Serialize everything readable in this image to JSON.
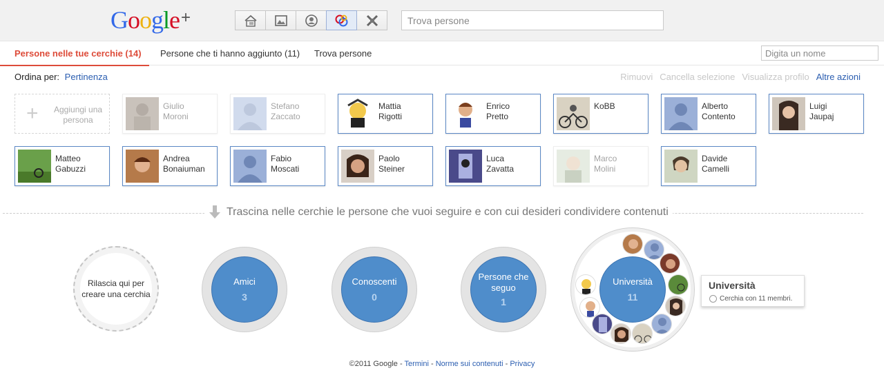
{
  "search": {
    "placeholder": "Trova persone"
  },
  "nav": [
    {
      "icon": "home-icon"
    },
    {
      "icon": "photos-icon"
    },
    {
      "icon": "profile-icon"
    },
    {
      "icon": "circles-icon"
    },
    {
      "icon": "games-icon"
    }
  ],
  "tabs": [
    {
      "label": "Persone nelle tue cerchie (14)"
    },
    {
      "label": "Persone che ti hanno aggiunto (11)"
    },
    {
      "label": "Trova persone"
    }
  ],
  "name_filter": {
    "placeholder": "Digita un nome"
  },
  "sort": {
    "label": "Ordina per:",
    "value": "Pertinenza"
  },
  "actions": [
    {
      "label": "Rimuovi"
    },
    {
      "label": "Cancella selezione"
    },
    {
      "label": "Visualizza profilo"
    },
    {
      "label": "Altre azioni"
    }
  ],
  "add_card": {
    "line1": "Aggiungi una",
    "line2": "persona"
  },
  "people_row1": [
    {
      "first": "Giulio",
      "last": "Moroni"
    },
    {
      "first": "Stefano",
      "last": "Zaccato"
    },
    {
      "first": "Mattia",
      "last": "Rigotti"
    },
    {
      "first": "Enrico",
      "last": "Pretto"
    },
    {
      "first": "KoBB",
      "last": ""
    },
    {
      "first": "Alberto",
      "last": "Contento"
    },
    {
      "first": "Luigi",
      "last": "Jaupaj"
    }
  ],
  "people_row2": [
    {
      "first": "Matteo",
      "last": "Gabuzzi"
    },
    {
      "first": "Andrea",
      "last": "Bonaiuman"
    },
    {
      "first": "Fabio",
      "last": "Moscati"
    },
    {
      "first": "Paolo",
      "last": "Steiner"
    },
    {
      "first": "Luca",
      "last": "Zavatta"
    },
    {
      "first": "Marco",
      "last": "Molini"
    },
    {
      "first": "Davide",
      "last": "Camelli"
    }
  ],
  "hint": "Trascina nelle cerchie le persone che vuoi seguire e con cui desideri condividere contenuti",
  "new_circle": "Rilascia qui per creare una cerchia",
  "circles": [
    {
      "name": "Amici",
      "count": "3"
    },
    {
      "name": "Conoscenti",
      "count": "0"
    },
    {
      "name": "Persone che seguo",
      "count": "1"
    },
    {
      "name": "Università",
      "count": "11"
    }
  ],
  "tooltip": {
    "title": "Università",
    "detail": "Cerchia con 11 membri."
  },
  "footer": {
    "copyright": "©2011 Google - ",
    "terms": "Termini",
    "sep1": " - ",
    "content": "Norme sui contenuti",
    "sep2": " - ",
    "privacy": "Privacy"
  },
  "colors": {
    "accent": "#dd4b39",
    "link": "#2a5db0",
    "circle": "#4f8dcb"
  }
}
